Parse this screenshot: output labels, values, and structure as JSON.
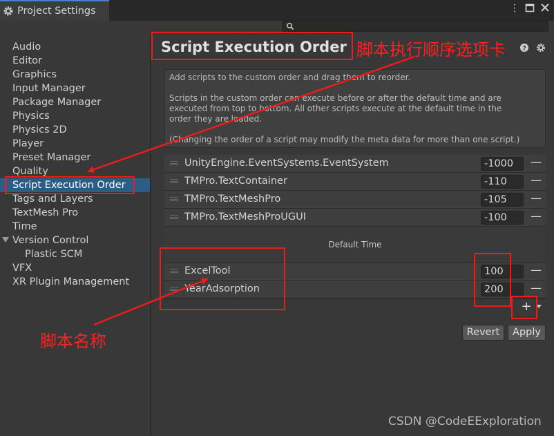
{
  "window": {
    "tab_title": "Project Settings",
    "icons": {
      "tab": "gear-icon",
      "more": "kebab-menu-icon",
      "maximize": "maximize-icon",
      "close": "close-icon",
      "search": "search-icon"
    }
  },
  "search": {
    "placeholder": "",
    "value": ""
  },
  "sidebar": {
    "items": [
      "Audio",
      "Editor",
      "Graphics",
      "Input Manager",
      "Package Manager",
      "Physics",
      "Physics 2D",
      "Player",
      "Preset Manager",
      "Quality",
      "Script Execution Order",
      "Tags and Layers",
      "TextMesh Pro",
      "Time",
      "Version Control",
      "Plastic SCM",
      "VFX",
      "XR Plugin Management"
    ],
    "selected": "Script Execution Order"
  },
  "page": {
    "title": "Script Execution Order",
    "info": [
      "Add scripts to the custom order and drag them to reorder.",
      "Scripts in the custom order can execute before or after the default time and are",
      "executed from top to bottom. All other scripts execute at the default time in the",
      "order they are loaded.",
      "(Changing the order of a script may modify the meta data for more than one script.)"
    ],
    "rows_before": [
      {
        "name": "UnityEngine.EventSystems.EventSystem",
        "value": "-1000"
      },
      {
        "name": "TMPro.TextContainer",
        "value": "-110"
      },
      {
        "name": "TMPro.TextMeshPro",
        "value": "-105"
      },
      {
        "name": "TMPro.TextMeshProUGUI",
        "value": "-100"
      }
    ],
    "default_time_label": "Default Time",
    "rows_after": [
      {
        "name": "ExcelTool",
        "value": "100"
      },
      {
        "name": "YearAdsorption",
        "value": "200"
      }
    ],
    "remove_label": "—",
    "add_label": "+",
    "revert_label": "Revert",
    "apply_label": "Apply"
  },
  "annotations": {
    "tab_note": "脚本执行顺序选项卡",
    "name_note": "脚本名称",
    "color": "#ee1b1b"
  },
  "watermark": "CSDN @CodeEExploration"
}
